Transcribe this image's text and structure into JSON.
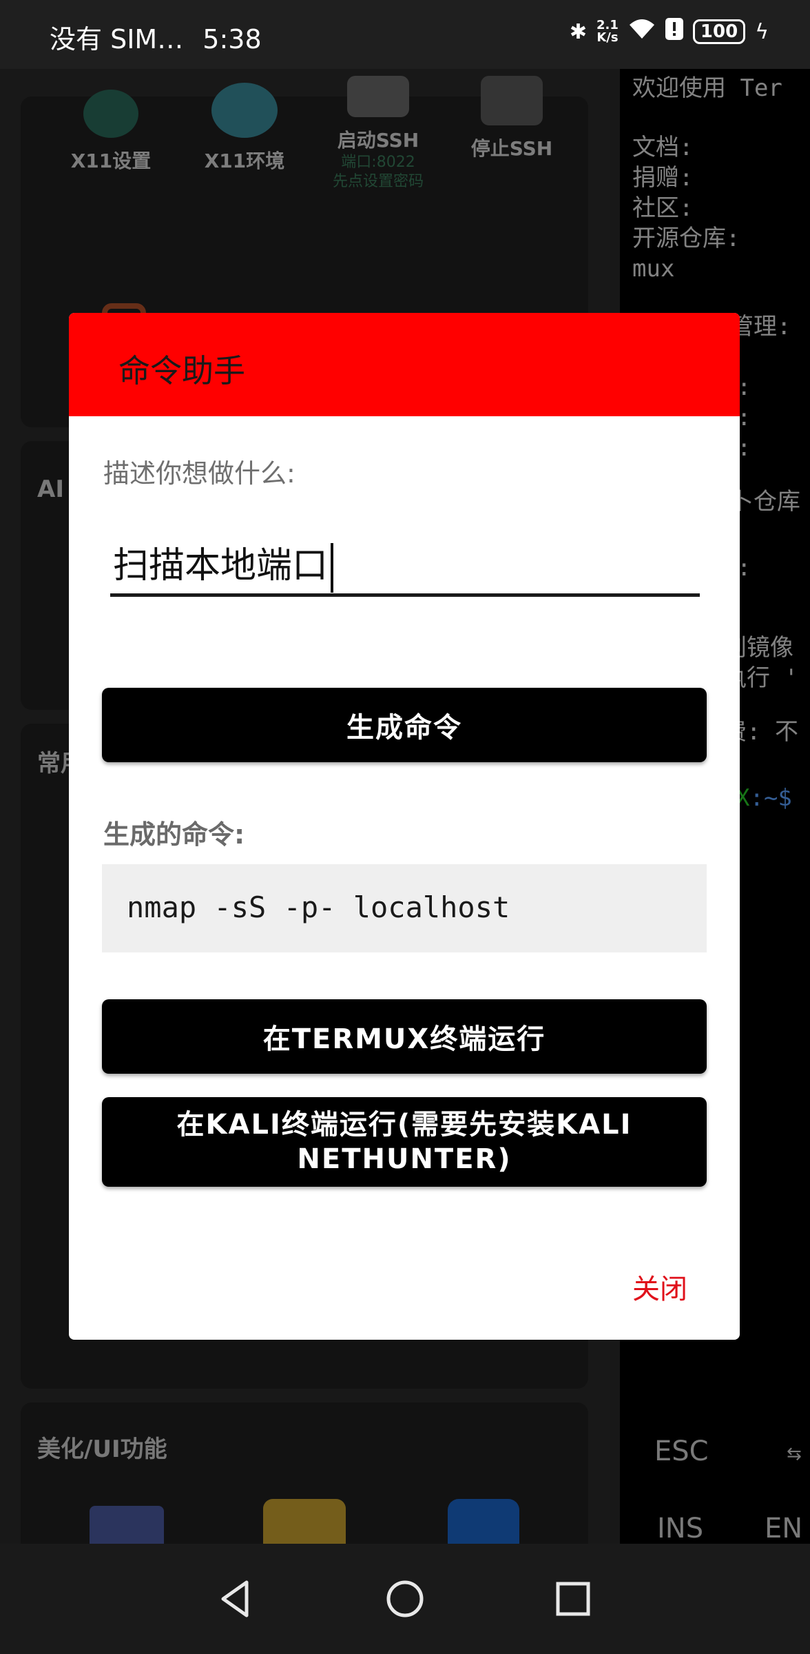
{
  "status_bar": {
    "carrier": "没有 SIM…",
    "time": "5:38",
    "speed_top": "2.1",
    "speed_bottom": "K/s",
    "battery": "100"
  },
  "background_app": {
    "tiles_row1": [
      {
        "label": "X11设置",
        "icon": "gear-icon"
      },
      {
        "label": "X11环境",
        "icon": "globe-icon"
      },
      {
        "label": "启动SSH",
        "sub1": "端口:8022",
        "sub2": "先点设置密码",
        "icon": "laptop-icon"
      },
      {
        "label": "停止SSH",
        "icon": "laptop-stop-icon"
      }
    ],
    "section_ai": "AI",
    "section_common": "常用",
    "section_ui": "美化/UI功能"
  },
  "terminal": {
    "lines": [
      "欢迎使用 Ter",
      "文档:",
      "捐赠:",
      "社区:",
      "开源仓库:",
      "mux",
      "管理:",
      ":",
      ":",
      ":",
      "卜仓库",
      ":",
      "创镜像",
      "执行 '",
      "费:  不"
    ],
    "prompt_host": "X",
    "prompt_path": ":~$",
    "extra_keys": [
      "ESC",
      "INS",
      "EN"
    ]
  },
  "dialog": {
    "title": "命令助手",
    "prompt_label": "描述你想做什么:",
    "input_value": "扫描本地端口",
    "generate_button": "生成命令",
    "output_label": "生成的命令:",
    "generated_command": "nmap -sS -p- localhost",
    "run_termux_button": "在TERMUX终端运行",
    "run_kali_button": "在KALI终端运行(需要先安装KALI NETHUNTER)",
    "close_button": "关闭"
  },
  "colors": {
    "dialog_header": "#ff0000",
    "close_text": "#e0101a",
    "button_bg": "#000000"
  }
}
